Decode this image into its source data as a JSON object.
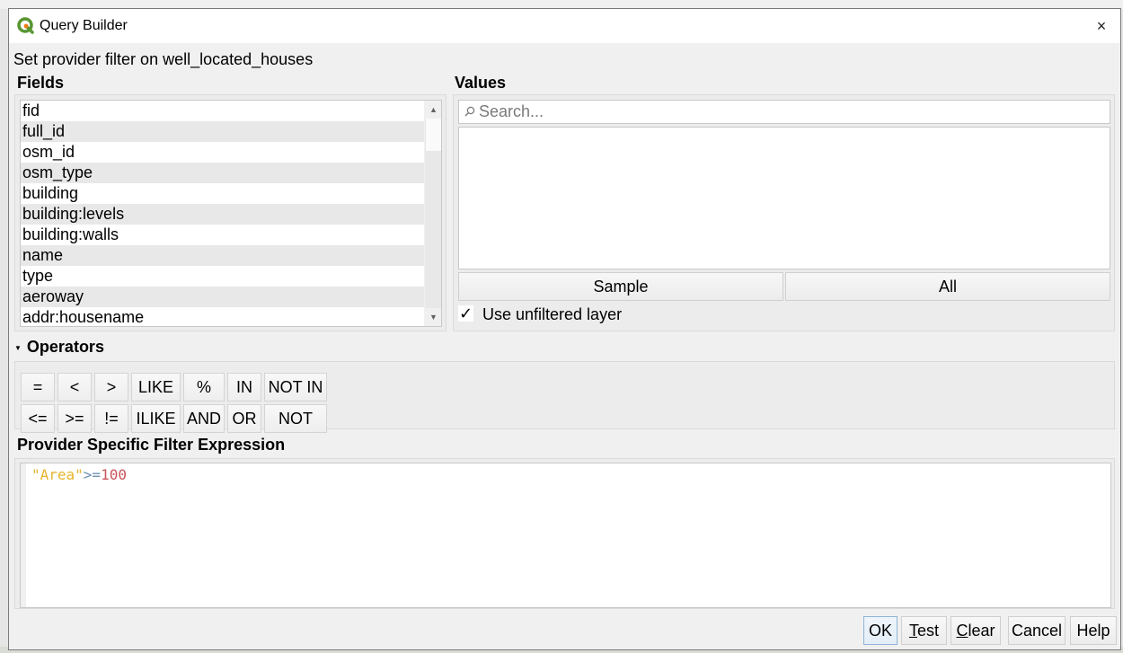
{
  "window": {
    "title": "Query Builder",
    "close_label": "×"
  },
  "subtitle": "Set provider filter on well_located_houses",
  "fields": {
    "label": "Fields",
    "items": [
      "fid",
      "full_id",
      "osm_id",
      "osm_type",
      "building",
      "building:levels",
      "building:walls",
      "name",
      "type",
      "aeroway",
      "addr:housename"
    ]
  },
  "values": {
    "label": "Values",
    "search_placeholder": "Search...",
    "search_value": "",
    "sample_label": "Sample",
    "all_label": "All",
    "use_unfiltered_label": "Use unfiltered layer",
    "use_unfiltered_checked": true,
    "check_glyph": "✓"
  },
  "operators": {
    "label": "Operators",
    "collapse_glyph": "▼",
    "row1": [
      "=",
      "<",
      ">",
      "LIKE",
      "%",
      "IN",
      "NOT IN"
    ],
    "row2": [
      "<=",
      ">=",
      "!=",
      "ILIKE",
      "AND",
      "OR",
      "NOT"
    ]
  },
  "expression": {
    "label": "Provider Specific Filter Expression",
    "tokens": {
      "field": "\"Area\"",
      "operator": ">=",
      "number": "100"
    }
  },
  "footer": {
    "ok": "OK",
    "test_first": "T",
    "test_rest": "est",
    "clear_first": "C",
    "clear_rest": "lear",
    "cancel": "Cancel",
    "help": "Help"
  },
  "colors": {
    "string_token": "#e5b52d",
    "operator_token": "#6f8fb2",
    "number_token": "#c9555a",
    "qgis_green": "#589632",
    "qgis_yellow": "#ee7913"
  }
}
